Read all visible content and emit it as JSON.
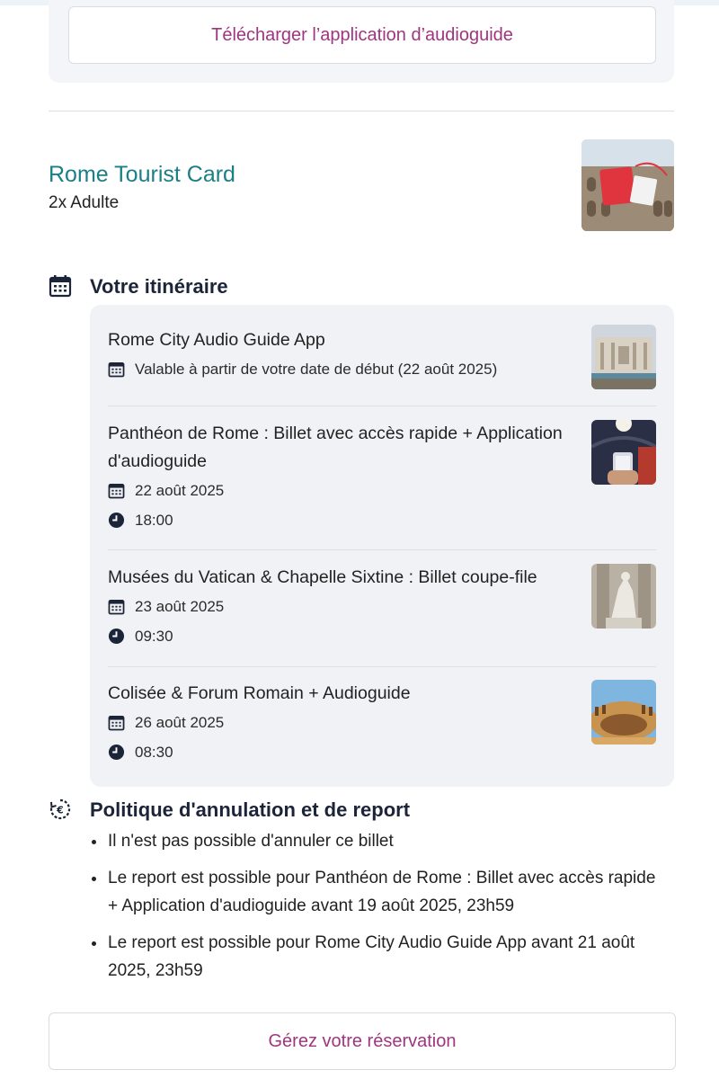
{
  "download": {
    "label": "Télécharger l’application d’audioguide"
  },
  "product": {
    "title": "Rome Tourist Card",
    "quantity": "2x Adulte"
  },
  "itinerary": {
    "heading": "Votre itinéraire",
    "items": [
      {
        "title": "Rome City Audio Guide App",
        "date": "Valable à partir de votre date de début (22 août 2025)",
        "time": null
      },
      {
        "title": "Panthéon de Rome : Billet avec accès rapide + Application d'audioguide",
        "date": "22 août 2025",
        "time": "18:00"
      },
      {
        "title": "Musées du Vatican & Chapelle Sixtine : Billet coupe-file",
        "date": "23 août 2025",
        "time": "09:30"
      },
      {
        "title": "Colisée & Forum Romain + Audioguide",
        "date": "26 août 2025",
        "time": "08:30"
      }
    ]
  },
  "policy": {
    "heading": "Politique d'annulation et de report",
    "items": [
      "Il n'est pas possible d'annuler ce billet",
      "Le report est possible pour Panthéon de Rome : Billet avec accès rapide + Application d'audioguide avant 19 août 2025, 23h59",
      "Le report est possible pour Rome City Audio Guide App avant 21 août 2025, 23h59"
    ]
  },
  "manage": {
    "label": "Gérez votre réservation"
  },
  "colors": {
    "accent_link": "#a0357f",
    "product_title": "#1a7f86",
    "icon": "#1c2438"
  }
}
